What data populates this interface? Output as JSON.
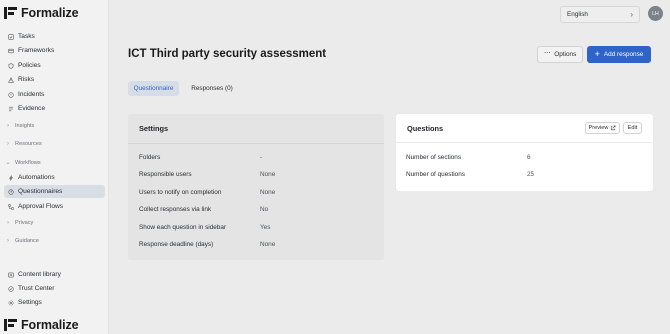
{
  "app": {
    "brand": "Formalize"
  },
  "sidebar": {
    "items": [
      {
        "label": "Tasks",
        "icon": "checklist-icon"
      },
      {
        "label": "Frameworks",
        "icon": "frameworks-icon"
      },
      {
        "label": "Policies",
        "icon": "shield-icon"
      },
      {
        "label": "Risks",
        "icon": "warning-triangle-icon"
      },
      {
        "label": "Incidents",
        "icon": "incident-icon"
      },
      {
        "label": "Evidence",
        "icon": "evidence-icon"
      }
    ],
    "groups": {
      "insights": "Insights",
      "resources": "Resources",
      "workflows": "Workflows",
      "privacy": "Privacy",
      "guidance": "Guidance"
    },
    "workflow_items": [
      {
        "label": "Automations",
        "icon": "lightning-icon"
      },
      {
        "label": "Questionnaires",
        "icon": "questionnaire-icon",
        "active": true
      },
      {
        "label": "Approval Flows",
        "icon": "approval-flow-icon"
      }
    ],
    "footer_items": [
      {
        "label": "Content library",
        "icon": "library-icon"
      },
      {
        "label": "Trust Center",
        "icon": "trust-center-icon"
      },
      {
        "label": "Settings",
        "icon": "gear-icon"
      }
    ]
  },
  "topbar": {
    "language": "English",
    "avatar_initials": "LH"
  },
  "header": {
    "title": "ICT Third party security assessment",
    "options_label": "Options",
    "add_response_label": "Add response"
  },
  "tabs": [
    {
      "label": "Questionnaire",
      "active": true
    },
    {
      "label": "Responses (0)",
      "active": false
    }
  ],
  "settings": {
    "title": "Settings",
    "rows": [
      {
        "label": "Folders",
        "value": "-"
      },
      {
        "label": "Responsible users",
        "value": "None"
      },
      {
        "label": "Users to notify on completion",
        "value": "None"
      },
      {
        "label": "Collect responses via link",
        "value": "No"
      },
      {
        "label": "Show each question in sidebar",
        "value": "Yes"
      },
      {
        "label": "Response deadline (days)",
        "value": "None"
      }
    ]
  },
  "questions": {
    "title": "Questions",
    "preview_label": "Preview",
    "edit_label": "Edit",
    "rows": [
      {
        "label": "Number of sections",
        "value": "6"
      },
      {
        "label": "Number of questions",
        "value": "25"
      }
    ]
  },
  "colors": {
    "accent": "#2e63c7",
    "active_tab_bg": "#d7dde7",
    "active_nav_bg": "#d9dde4"
  }
}
